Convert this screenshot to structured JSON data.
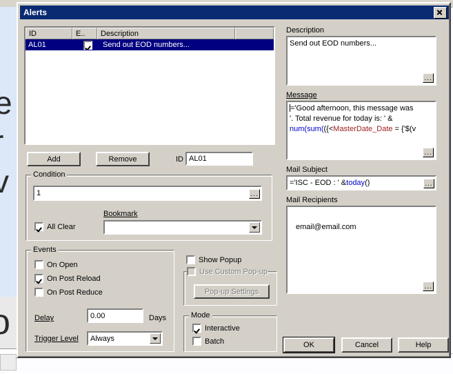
{
  "background": {
    "big_text_fragment_1": "e",
    "big_text_fragment_2": "r",
    "big_text_fragment_3": "v",
    "big_text_fragment_4": "o"
  },
  "window": {
    "title": "Alerts",
    "close_label": "Close"
  },
  "list": {
    "columns": [
      "ID",
      "E..",
      "Description",
      ""
    ],
    "rows": [
      {
        "id": "AL01",
        "enabled": true,
        "description": "Send out EOD numbers..."
      }
    ]
  },
  "buttons": {
    "add": "Add",
    "remove": "Remove",
    "popup_settings": "Pop-up Settings",
    "ok": "OK",
    "cancel": "Cancel",
    "help": "Help",
    "ellipsis": "..."
  },
  "id_field": {
    "label": "ID",
    "value": "AL01"
  },
  "condition": {
    "title": "Condition",
    "expression": "1",
    "all_clear_label": "All Clear",
    "all_clear_checked": true,
    "bookmark_label": "Bookmark",
    "bookmark_value": ""
  },
  "events": {
    "title": "Events",
    "on_open_label": "On Open",
    "on_open_checked": false,
    "on_post_reload_label": "On Post Reload",
    "on_post_reload_checked": true,
    "on_post_reduce_label": "On Post Reduce",
    "on_post_reduce_checked": false,
    "delay_label": "Delay",
    "delay_value": "0.00",
    "delay_units": "Days",
    "trigger_level_label": "Trigger Level",
    "trigger_level_value": "Always",
    "trigger_level_options": [
      "Always"
    ]
  },
  "popup": {
    "show_popup_label": "Show Popup",
    "show_popup_checked": false,
    "use_custom_label": "Use Custom Pop-up",
    "use_custom_checked": false,
    "use_custom_disabled": true
  },
  "mode": {
    "title": "Mode",
    "interactive_label": "Interactive",
    "interactive_checked": true,
    "batch_label": "Batch",
    "batch_checked": false
  },
  "description": {
    "label": "Description",
    "value": "Send out EOD numbers..."
  },
  "message": {
    "label": "Message",
    "line1_plain": "='Good afternoon, this message was",
    "line2_plain": "'. Total revenue for today is: ' &",
    "line3_kw1": "num(",
    "line3_kw2": "sum(",
    "line3_mid": "({<",
    "line3_field": "MasterDate_Date",
    "line3_tail": " = {'$(v"
  },
  "mail_subject": {
    "label": "Mail Subject",
    "prefix": "='ISC - EOD : ' & ",
    "func": "today",
    "suffix": "()"
  },
  "mail_recipients": {
    "label": "Mail Recipients",
    "value": "email@email.com"
  },
  "colors": {
    "titlebar": "#0a2a72",
    "dialog_face": "#d4d0c8",
    "selection": "#000080",
    "keyword": "#0000c8",
    "field": "#9c2020"
  }
}
